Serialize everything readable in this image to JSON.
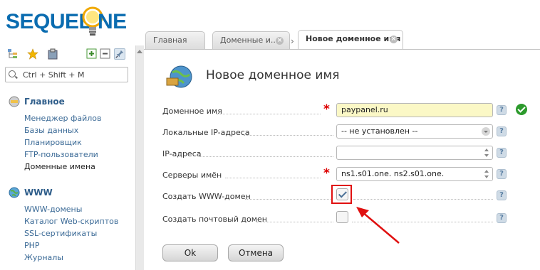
{
  "brand": {
    "logo_left": "SEQUEL.",
    "logo_right": "NE"
  },
  "sidebar": {
    "search_placeholder": "Ctrl + Shift + M",
    "sections": [
      {
        "title": "Главное",
        "icon": "disk-icon",
        "items": [
          "Менеджер файлов",
          "Базы данных",
          "Планировщик",
          "FTP-пользователи",
          "Доменные имена"
        ]
      },
      {
        "title": "WWW",
        "icon": "globe-icon",
        "items": [
          "WWW-домены",
          "Каталог Web-скриптов",
          "SSL-сертификаты",
          "PHP",
          "Журналы"
        ]
      }
    ],
    "active_item": "Доменные имена"
  },
  "tabs": [
    {
      "label": "Главная"
    },
    {
      "label": "Доменные и..."
    },
    {
      "label": "Новое доменное имя"
    }
  ],
  "page": {
    "title": "Новое доменное имя"
  },
  "form": {
    "domain_label": "Доменное имя",
    "domain_value": "paypanel.ru",
    "local_ip_label": "Локальные IP-адреса",
    "local_ip_value": "-- не установлен --",
    "ip_label": "IP-адреса",
    "ip_value": "",
    "ns_label": "Серверы имён",
    "ns_value": "ns1.s01.one. ns2.s01.one.",
    "www_label": "Создать WWW-домен",
    "www_checked": true,
    "mail_label": "Создать почтовый домен",
    "mail_checked": false,
    "help": "?"
  },
  "buttons": {
    "ok": "Ok",
    "cancel": "Отмена"
  },
  "colors": {
    "accent": "#0a6cb0",
    "required": "#dd0000",
    "highlight": "#e01010",
    "success": "#2c9a2c"
  }
}
